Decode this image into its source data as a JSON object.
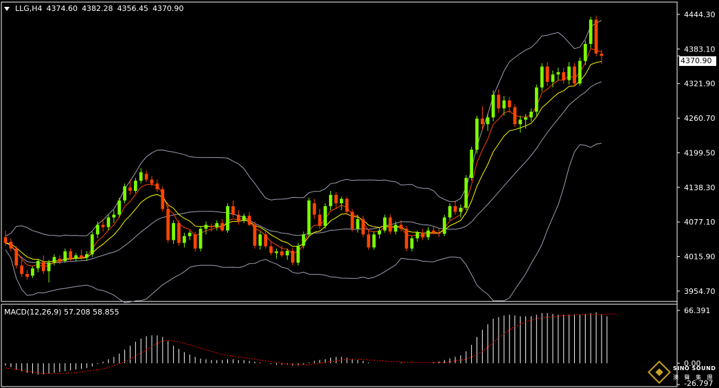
{
  "header": {
    "symbol": "LLG,H4",
    "open": "4374.60",
    "high": "4382.28",
    "low": "4356.45",
    "close": "4370.90"
  },
  "price_axis": {
    "ticks": [
      "4444.30",
      "4383.10",
      "4321.90",
      "4260.70",
      "4199.50",
      "4138.30",
      "4077.10",
      "4015.90",
      "3954.70"
    ],
    "last_price": "4370.90"
  },
  "macd": {
    "title": "MACD(12,26,9) 57.208 58.855",
    "ticks": [
      "66.391",
      "0.00",
      "-26.797"
    ]
  },
  "logo": {
    "name": "SINO SOUND",
    "cn": "澳 聲 集 團"
  },
  "colors": {
    "background": "#000000",
    "up_candle": "#7cfc00",
    "down_candle": "#ff4500",
    "ma_fast": "#ff4500",
    "ma_slow": "#ffff00",
    "bands": "#a0a0b4",
    "grid": "#ffffff",
    "macd_hist": "#ffffff",
    "macd_signal": "#ff0000"
  },
  "chart_data": [
    {
      "type": "candlestick",
      "symbol": "LLG",
      "timeframe": "H4",
      "ylim": [
        3940,
        4460
      ],
      "candles": [
        [
          4050,
          4062,
          4035,
          4040
        ],
        [
          4042,
          4048,
          4025,
          4030
        ],
        [
          4030,
          4034,
          3995,
          4000
        ],
        [
          4000,
          4010,
          3980,
          3985
        ],
        [
          3985,
          3992,
          3975,
          3980
        ],
        [
          3982,
          3998,
          3978,
          3995
        ],
        [
          3995,
          4012,
          3988,
          4008
        ],
        [
          4006,
          4018,
          3985,
          3990
        ],
        [
          3990,
          4010,
          3970,
          4005
        ],
        [
          4005,
          4020,
          4000,
          4015
        ],
        [
          4012,
          4018,
          4002,
          4008
        ],
        [
          4008,
          4030,
          4005,
          4025
        ],
        [
          4025,
          4030,
          4008,
          4012
        ],
        [
          4012,
          4022,
          4008,
          4018
        ],
        [
          4018,
          4028,
          4010,
          4014
        ],
        [
          4014,
          4025,
          4008,
          4020
        ],
        [
          4020,
          4060,
          4015,
          4055
        ],
        [
          4055,
          4078,
          4048,
          4072
        ],
        [
          4072,
          4082,
          4060,
          4068
        ],
        [
          4068,
          4090,
          4062,
          4085
        ],
        [
          4085,
          4098,
          4075,
          4090
        ],
        [
          4090,
          4120,
          4085,
          4115
        ],
        [
          4115,
          4145,
          4110,
          4140
        ],
        [
          4138,
          4152,
          4125,
          4132
        ],
        [
          4132,
          4155,
          4128,
          4150
        ],
        [
          4150,
          4172,
          4145,
          4165
        ],
        [
          4162,
          4168,
          4148,
          4152
        ],
        [
          4152,
          4158,
          4140,
          4145
        ],
        [
          4145,
          4152,
          4130,
          4135
        ],
        [
          4135,
          4140,
          4095,
          4100
        ],
        [
          4100,
          4110,
          4040,
          4045
        ],
        [
          4045,
          4080,
          4038,
          4075
        ],
        [
          4075,
          4080,
          4035,
          4040
        ],
        [
          4040,
          4058,
          4032,
          4052
        ],
        [
          4052,
          4062,
          4045,
          4058
        ],
        [
          4055,
          4060,
          4025,
          4030
        ],
        [
          4030,
          4070,
          4025,
          4065
        ],
        [
          4065,
          4078,
          4055,
          4072
        ],
        [
          4070,
          4074,
          4060,
          4068
        ],
        [
          4068,
          4080,
          4062,
          4075
        ],
        [
          4075,
          4082,
          4060,
          4062
        ],
        [
          4062,
          4110,
          4058,
          4105
        ],
        [
          4105,
          4115,
          4085,
          4090
        ],
        [
          4090,
          4098,
          4072,
          4078
        ],
        [
          4080,
          4092,
          4075,
          4088
        ],
        [
          4088,
          4095,
          4070,
          4072
        ],
        [
          4072,
          4078,
          4030,
          4035
        ],
        [
          4035,
          4060,
          4028,
          4055
        ],
        [
          4055,
          4060,
          4030,
          4034
        ],
        [
          4034,
          4042,
          4018,
          4022
        ],
        [
          4022,
          4030,
          4012,
          4025
        ],
        [
          4025,
          4035,
          4015,
          4018
        ],
        [
          4018,
          4030,
          4010,
          4026
        ],
        [
          4026,
          4032,
          4000,
          4005
        ],
        [
          4005,
          4040,
          4000,
          4035
        ],
        [
          4035,
          4060,
          4030,
          4055
        ],
        [
          4055,
          4120,
          4050,
          4115
        ],
        [
          4110,
          4118,
          4082,
          4090
        ],
        [
          4090,
          4100,
          4065,
          4070
        ],
        [
          4070,
          4110,
          4065,
          4105
        ],
        [
          4105,
          4132,
          4098,
          4125
        ],
        [
          4125,
          4130,
          4100,
          4110
        ],
        [
          4110,
          4122,
          4098,
          4118
        ],
        [
          4118,
          4122,
          4090,
          4095
        ],
        [
          4095,
          4100,
          4060,
          4065
        ],
        [
          4065,
          4090,
          4058,
          4082
        ],
        [
          4082,
          4088,
          4050,
          4055
        ],
        [
          4055,
          4062,
          4028,
          4032
        ],
        [
          4032,
          4060,
          4028,
          4055
        ],
        [
          4055,
          4068,
          4048,
          4062
        ],
        [
          4062,
          4090,
          4058,
          4085
        ],
        [
          4085,
          4090,
          4055,
          4060
        ],
        [
          4060,
          4078,
          4055,
          4072
        ],
        [
          4072,
          4080,
          4060,
          4065
        ],
        [
          4065,
          4070,
          4025,
          4030
        ],
        [
          4030,
          4052,
          4025,
          4048
        ],
        [
          4048,
          4062,
          4042,
          4058
        ],
        [
          4058,
          4065,
          4045,
          4050
        ],
        [
          4050,
          4068,
          4045,
          4062
        ],
        [
          4062,
          4070,
          4055,
          4058
        ],
        [
          4058,
          4065,
          4050,
          4056
        ],
        [
          4056,
          4090,
          4052,
          4085
        ],
        [
          4085,
          4110,
          4080,
          4105
        ],
        [
          4105,
          4115,
          4090,
          4095
        ],
        [
          4095,
          4108,
          4085,
          4102
        ],
        [
          4102,
          4160,
          4098,
          4155
        ],
        [
          4155,
          4210,
          4150,
          4205
        ],
        [
          4205,
          4265,
          4198,
          4260
        ],
        [
          4260,
          4282,
          4240,
          4250
        ],
        [
          4250,
          4268,
          4238,
          4262
        ],
        [
          4262,
          4310,
          4255,
          4302
        ],
        [
          4302,
          4312,
          4270,
          4278
        ],
        [
          4278,
          4300,
          4265,
          4292
        ],
        [
          4292,
          4298,
          4270,
          4280
        ],
        [
          4280,
          4285,
          4245,
          4250
        ],
        [
          4250,
          4265,
          4235,
          4258
        ],
        [
          4258,
          4268,
          4242,
          4262
        ],
        [
          4262,
          4278,
          4255,
          4272
        ],
        [
          4272,
          4320,
          4265,
          4315
        ],
        [
          4315,
          4358,
          4308,
          4352
        ],
        [
          4352,
          4360,
          4318,
          4325
        ],
        [
          4325,
          4345,
          4315,
          4338
        ],
        [
          4338,
          4350,
          4328,
          4342
        ],
        [
          4342,
          4350,
          4322,
          4328
        ],
        [
          4328,
          4360,
          4320,
          4352
        ],
        [
          4352,
          4358,
          4318,
          4322
        ],
        [
          4322,
          4368,
          4318,
          4362
        ],
        [
          4362,
          4398,
          4355,
          4392
        ],
        [
          4392,
          4440,
          4385,
          4435
        ],
        [
          4435,
          4442,
          4370,
          4375
        ],
        [
          4374.6,
          4382.28,
          4356.45,
          4370.9
        ]
      ]
    },
    {
      "type": "bar",
      "title": "MACD(12,26,9) 57.208 58.855",
      "ylim": [
        -26.797,
        66.391
      ],
      "series": [
        {
          "name": "MACD",
          "values": [
            -3,
            -5,
            -8,
            -10,
            -12,
            -13,
            -14,
            -14,
            -13,
            -12,
            -11,
            -10,
            -9,
            -8,
            -7,
            -6,
            -4,
            -1,
            2,
            5,
            8,
            12,
            17,
            22,
            27,
            31,
            34,
            35,
            35,
            33,
            28,
            22,
            18,
            14,
            11,
            8,
            6,
            5,
            4,
            4,
            4,
            5,
            5,
            4,
            4,
            3,
            2,
            1,
            0,
            -1,
            -2,
            -2,
            -2,
            -3,
            -3,
            -2,
            1,
            3,
            4,
            5,
            7,
            8,
            8,
            7,
            5,
            4,
            3,
            1,
            0,
            0,
            0,
            0,
            0,
            1,
            0,
            0,
            0,
            0,
            0,
            1,
            2,
            4,
            6,
            8,
            10,
            15,
            23,
            33,
            42,
            49,
            56,
            58,
            60,
            61,
            60,
            59,
            59,
            59,
            61,
            63,
            63,
            62,
            61,
            61,
            61,
            61,
            61,
            62,
            63,
            64,
            62,
            59
          ]
        },
        {
          "name": "Signal",
          "values": [
            -6,
            -7,
            -8,
            -9,
            -10,
            -11,
            -12,
            -13,
            -13,
            -13,
            -13,
            -13,
            -12,
            -12,
            -11,
            -10,
            -9,
            -8,
            -7,
            -5,
            -3,
            -1,
            2,
            5,
            9,
            13,
            17,
            21,
            25,
            28,
            29,
            28,
            27,
            25,
            23,
            21,
            19,
            17,
            15,
            13,
            11,
            10,
            9,
            8,
            7,
            6,
            5,
            4,
            3,
            2,
            1,
            0,
            -1,
            -1,
            -2,
            -2,
            -2,
            -1,
            0,
            1,
            2,
            3,
            4,
            5,
            5,
            5,
            5,
            4,
            4,
            3,
            3,
            2,
            2,
            2,
            1,
            1,
            1,
            1,
            1,
            1,
            1,
            1,
            2,
            3,
            4,
            5,
            8,
            11,
            15,
            20,
            26,
            32,
            37,
            42,
            46,
            49,
            52,
            54,
            56,
            57,
            58,
            59,
            59,
            60,
            60,
            61,
            61,
            61,
            61,
            61,
            61,
            62,
            62,
            61
          ]
        }
      ]
    }
  ]
}
